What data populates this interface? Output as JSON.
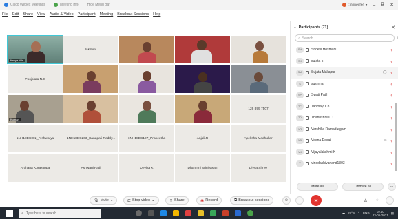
{
  "titlebar": {
    "tabs": [
      {
        "label": "Cisco Webex Meetings"
      },
      {
        "label": "Meeting Info"
      },
      {
        "label": "Hide Menu Bar"
      }
    ],
    "connection": "Connected",
    "window_controls": [
      "–",
      "⧉",
      "✕"
    ]
  },
  "menubar": {
    "items": [
      "File",
      "Edit",
      "Share",
      "View",
      "Audio & Video",
      "Participant",
      "Meeting",
      "Breakout Sessions",
      "Help"
    ]
  },
  "video_tiles": [
    {
      "name": "Kavya N.K",
      "type": "video",
      "active": true
    },
    {
      "name": "lakshmi",
      "type": "name"
    },
    {
      "name": "",
      "type": "video"
    },
    {
      "name": "",
      "type": "video"
    },
    {
      "name": "",
      "type": "video"
    },
    {
      "name": "Poojalata N.S",
      "type": "name"
    },
    {
      "name": "",
      "type": "video"
    },
    {
      "name": "",
      "type": "video"
    },
    {
      "name": "",
      "type": "video"
    },
    {
      "name": "",
      "type": "video"
    },
    {
      "name": "Kumari",
      "type": "video"
    },
    {
      "name": "",
      "type": "video"
    },
    {
      "name": "",
      "type": "video"
    },
    {
      "name": "",
      "type": "video"
    },
    {
      "name": "126 899 7507",
      "type": "name"
    },
    {
      "name": "1NH18EC002_Aishwarya",
      "type": "name"
    },
    {
      "name": "1NH18EC203_Kanapati Reddy...",
      "type": "name"
    },
    {
      "name": "1NH18EC127_Praneetha",
      "type": "name"
    },
    {
      "name": "Anjali.R",
      "type": "name"
    },
    {
      "name": "Apeksha Madhukar",
      "type": "name"
    },
    {
      "name": "Archana Korakoppa",
      "type": "name"
    },
    {
      "name": "Ashwani Patil",
      "type": "name"
    },
    {
      "name": "Devika K",
      "type": "name"
    },
    {
      "name": "Dhanmni Srinivasan",
      "type": "name"
    },
    {
      "name": "Divya Shree",
      "type": "name"
    }
  ],
  "participants": {
    "title": "Participants (71)",
    "search_placeholder": "Search",
    "items": [
      {
        "initials": "SH",
        "name": "Sridevi Hosmani",
        "cam": false,
        "mic": "🎙"
      },
      {
        "initials": "SK",
        "name": "sujata k",
        "cam": false,
        "mic": "🎙"
      },
      {
        "initials": "SM",
        "name": "Sujata Mallapur",
        "cam": false,
        "mic": "🎙",
        "highlight": true
      },
      {
        "initials": "S",
        "name": "sushma",
        "cam": false,
        "mic": "🎙"
      },
      {
        "initials": "SP",
        "name": "Swati Patil",
        "cam": false,
        "mic": "🎙"
      },
      {
        "initials": "TC",
        "name": "Tanmayi Ch",
        "cam": false,
        "mic": "🎙"
      },
      {
        "initials": "TD",
        "name": "Thanushree D",
        "cam": false,
        "mic": "🎙"
      },
      {
        "initials": "VR",
        "name": "Varshika Ramadurgam",
        "cam": false,
        "mic": "🎙"
      },
      {
        "initials": "VD",
        "name": "Veena Desai",
        "cam": true,
        "mic": "🎙"
      },
      {
        "initials": "VK",
        "name": "Vijayalakshmi K",
        "cam": false,
        "mic": "🎙"
      },
      {
        "initials": "V",
        "name": "vinodashivanand1303",
        "cam": false,
        "mic": "🎙"
      }
    ],
    "mute_all": "Mute all",
    "unmute_all": "Unmute all"
  },
  "controls": {
    "mute": "Mute",
    "stop_video": "Stop video",
    "share": "Share",
    "record": "Record",
    "breakout": "Breakout sessions"
  },
  "taskbar": {
    "search_placeholder": "Type here to search",
    "weather": "29°C",
    "lang": "ENG",
    "time": "19:40",
    "date": "23-06-2021"
  },
  "colors": {
    "accent": "#41c7d6",
    "end_call": "#e2342f",
    "muted_mic": "#d93a3a",
    "taskbar": "#232a33"
  }
}
